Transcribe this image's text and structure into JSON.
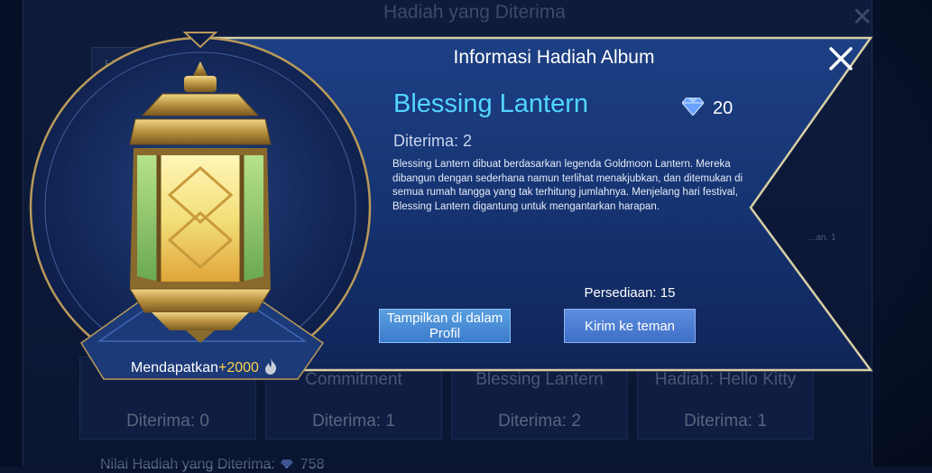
{
  "background": {
    "title": "Hadiah yang Diterima",
    "tab_label": "Hari",
    "badge_text": "...an. 1",
    "cards": [
      {
        "name": "",
        "received": "Diterima: 0"
      },
      {
        "name": "Commitment",
        "received": "Diterima: 1"
      },
      {
        "name": "Blessing Lantern",
        "received": "Diterima: 2"
      },
      {
        "name": "Hadiah: Hello Kitty",
        "received": "Diterima: 1"
      }
    ],
    "footer_label": "Nilai Hadiah yang Diterima:",
    "footer_value": "758"
  },
  "dialog": {
    "title": "Informasi Hadiah Album",
    "item_name": "Blessing Lantern",
    "price": "20",
    "received": "Diterima: 2",
    "description": "Blessing Lantern dibuat berdasarkan legenda Goldmoon Lantern. Mereka dibangun dengan sederhana namun terlihat menakjubkan, dan ditemukan di semua rumah tangga yang tak terhitung jumlahnya. Menjelang hari festival, Blessing Lantern digantung untuk mengantarkan harapan.",
    "stock": "Persediaan: 15",
    "show_button": "Tampilkan di dalam Profil",
    "send_button": "Kirim ke teman",
    "earn_prefix": "Mendapatkan",
    "earn_amount": "+2000"
  },
  "icons": {
    "currency": "diamond-icon",
    "close": "close-icon",
    "popularity": "flame-icon"
  },
  "colors": {
    "item_name": "#52d6ff",
    "earn_amount": "#ffd24a",
    "frame_gold": "#b99a5a"
  }
}
